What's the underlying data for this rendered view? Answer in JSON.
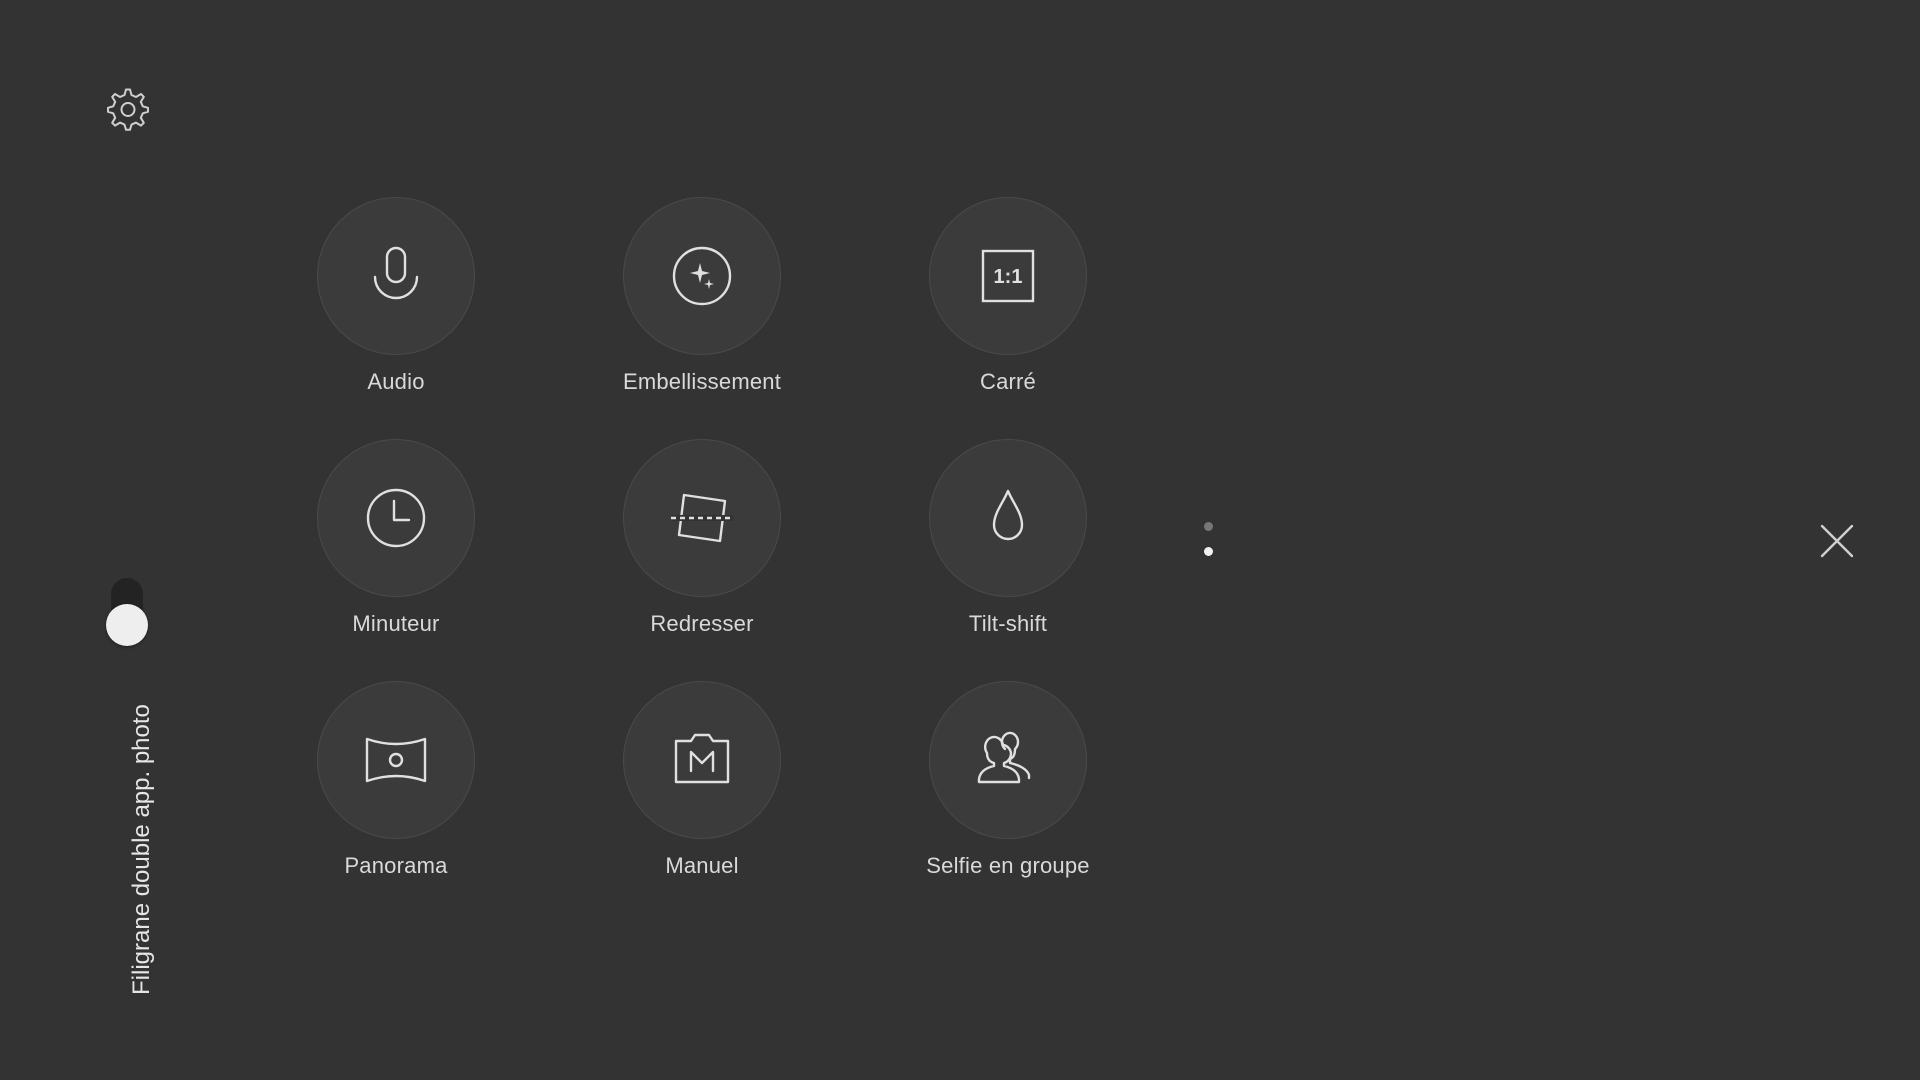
{
  "colors": {
    "background": "#333333",
    "circle_fill": "#3b3b3b",
    "icon_stroke": "#e0e0e0",
    "label_text": "#d9d9d9",
    "toggle_knob": "#eeeeee"
  },
  "toolbar": {
    "settings_icon": "gear-icon",
    "close_icon": "close-icon"
  },
  "modes": [
    {
      "label": "Audio",
      "icon": "microphone-icon"
    },
    {
      "label": "Embellissement",
      "icon": "sparkle-icon"
    },
    {
      "label": "Carré",
      "icon": "square-ratio-icon",
      "icon_text": "1:1"
    },
    {
      "label": "Minuteur",
      "icon": "clock-icon"
    },
    {
      "label": "Redresser",
      "icon": "straighten-icon"
    },
    {
      "label": "Tilt-shift",
      "icon": "droplet-icon"
    },
    {
      "label": "Panorama",
      "icon": "panorama-icon"
    },
    {
      "label": "Manuel",
      "icon": "manual-camera-icon"
    },
    {
      "label": "Selfie en groupe",
      "icon": "group-icon"
    }
  ],
  "pagination": {
    "total_pages": 2,
    "current_page": 2
  },
  "dual_camera_watermark": {
    "label": "Filigrane double app. photo",
    "enabled": true
  }
}
